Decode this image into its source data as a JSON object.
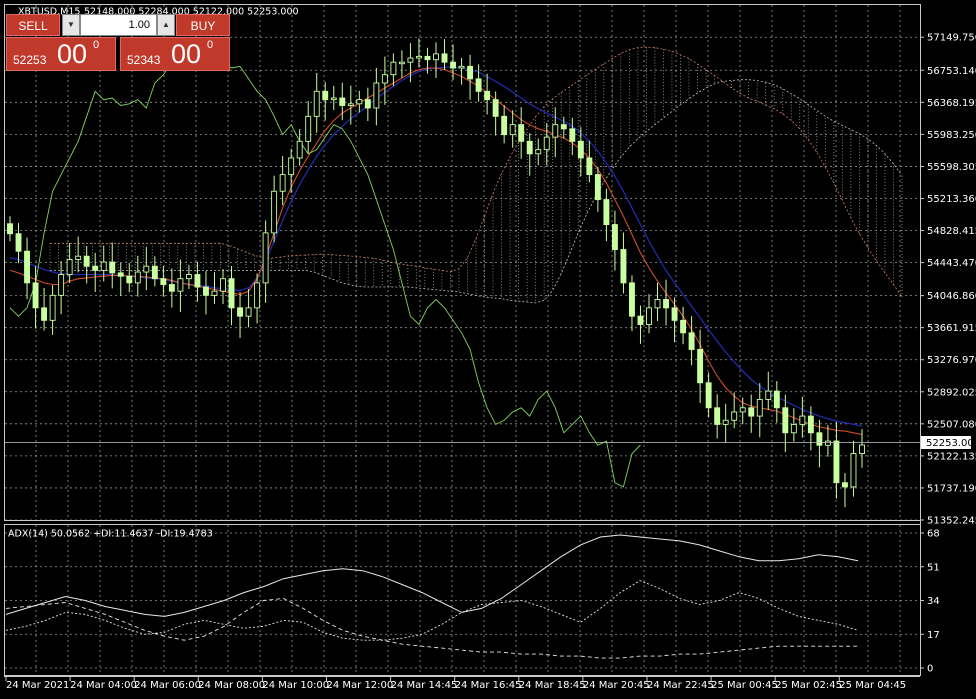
{
  "header": {
    "symbol": "XBTUSD,M15",
    "ohlc": "52148.000 52284.000 52122.000 52253.000"
  },
  "trade_panel": {
    "sell_label": "SELL",
    "buy_label": "BUY",
    "volume": "1.00",
    "sell_price_small": "52253",
    "sell_price_big": "00",
    "sell_price_sup": "0",
    "buy_price_small": "52343",
    "buy_price_big": "00",
    "buy_price_sup": "0",
    "step_down_icon": "triangle-down-icon",
    "step_up_icon": "triangle-up-icon"
  },
  "colors": {
    "background": "#000000",
    "grid": "#c8c8c8",
    "bull": "#c8ffa0",
    "ma_fast": "#d24a2c",
    "ma_slow": "#1f2aa8",
    "chikou": "#7fd65a",
    "cloud": "#c8c8c8",
    "panel_red": "#c0392b"
  },
  "chart_data": [
    {
      "type": "candlestick",
      "title": "XBTUSD,M15",
      "ylim": [
        51352.245,
        57536.9
      ],
      "yticks": [
        "57149.750",
        "56753.140",
        "56368.195",
        "55983.250",
        "55598.305",
        "55213.360",
        "54828.415",
        "54443.470",
        "54046.860",
        "53661.915",
        "53276.970",
        "52892.025",
        "52507.080",
        "52122.135",
        "51737.190",
        "51352.245"
      ],
      "current_price": "52253.000",
      "grid": true,
      "close": [
        54790,
        54580,
        54200,
        53900,
        53750,
        54050,
        54300,
        54480,
        54520,
        54400,
        54350,
        54450,
        54320,
        54280,
        54200,
        54330,
        54400,
        54250,
        54180,
        54100,
        54250,
        54300,
        54150,
        54050,
        54100,
        54250,
        53900,
        53800,
        53900,
        54200,
        54800,
        55300,
        55500,
        55700,
        55900,
        56200,
        56500,
        56400,
        56420,
        56330,
        56350,
        56400,
        56300,
        56600,
        56700,
        56850,
        56850,
        56900,
        56920,
        56880,
        56950,
        56850,
        56780,
        56800,
        56650,
        56500,
        56400,
        56200,
        55980,
        56100,
        55900,
        55750,
        55800,
        55950,
        56100,
        56050,
        55900,
        55700,
        55500,
        55200,
        54900,
        54600,
        54200,
        53800,
        53700,
        53900,
        54000,
        53900,
        53750,
        53600,
        53400,
        53000,
        52700,
        52500,
        52550,
        52650,
        52700,
        52600,
        52800,
        52900,
        52700,
        52400,
        52500,
        52600,
        52400,
        52250,
        52300,
        51800,
        51750,
        52150,
        52253
      ],
      "ma_fast": [
        54350,
        54320,
        54280,
        54240,
        54200,
        54180,
        54180,
        54220,
        54250,
        54260,
        54270,
        54280,
        54290,
        54290,
        54280,
        54280,
        54270,
        54260,
        54250,
        54230,
        54200,
        54180,
        54160,
        54140,
        54120,
        54100,
        54080,
        54060,
        54100,
        54250,
        54500,
        54800,
        55100,
        55350,
        55550,
        55720,
        55880,
        56030,
        56150,
        56240,
        56300,
        56360,
        56420,
        56480,
        56540,
        56600,
        56660,
        56720,
        56760,
        56780,
        56780,
        56760,
        56720,
        56680,
        56620,
        56560,
        56480,
        56400,
        56320,
        56240,
        56160,
        56100,
        56050,
        56020,
        55980,
        55940,
        55880,
        55800,
        55700,
        55560,
        55400,
        55200,
        55000,
        54780,
        54560,
        54380,
        54220,
        54080,
        53940,
        53800,
        53640,
        53460,
        53260,
        53080,
        52940,
        52840,
        52760,
        52720,
        52700,
        52680,
        52660,
        52620,
        52580,
        52540,
        52500,
        52470,
        52450,
        52430,
        52420,
        52400,
        52380
      ],
      "ma_slow": [
        54500,
        54480,
        54440,
        54400,
        54360,
        54330,
        54310,
        54300,
        54300,
        54300,
        54300,
        54300,
        54300,
        54290,
        54280,
        54270,
        54260,
        54250,
        54240,
        54220,
        54200,
        54180,
        54170,
        54160,
        54140,
        54130,
        54120,
        54110,
        54140,
        54260,
        54460,
        54700,
        54950,
        55180,
        55380,
        55560,
        55720,
        55860,
        55980,
        56080,
        56170,
        56250,
        56330,
        56410,
        56490,
        56560,
        56630,
        56690,
        56740,
        56770,
        56780,
        56790,
        56790,
        56780,
        56760,
        56730,
        56680,
        56620,
        56560,
        56490,
        56420,
        56350,
        56290,
        56240,
        56190,
        56140,
        56080,
        56000,
        55900,
        55780,
        55640,
        55480,
        55300,
        55100,
        54900,
        54700,
        54520,
        54350,
        54200,
        54060,
        53920,
        53780,
        53640,
        53500,
        53370,
        53250,
        53140,
        53040,
        52960,
        52890,
        52830,
        52780,
        52730,
        52680,
        52640,
        52600,
        52570,
        52540,
        52520,
        52500,
        52480
      ]
    },
    {
      "type": "line",
      "title": "ADX(14) 50.0562 +DI:11.4637 -DI:19.4783",
      "indicator": "ADX(14)",
      "adx": "50.0562",
      "plus_di": "11.4637",
      "minus_di": "19.4783",
      "ylim": [
        0,
        68
      ],
      "yticks": [
        "68",
        "51",
        "34",
        "17",
        "0"
      ],
      "x_labels": [
        "24 Mar 2021",
        "24 Mar 04:00",
        "24 Mar 06:00",
        "24 Mar 08:00",
        "24 Mar 10:00",
        "24 Mar 12:00",
        "24 Mar 14:45",
        "24 Mar 16:45",
        "24 Mar 18:45",
        "24 Mar 20:45",
        "24 Mar 22:45",
        "25 Mar 00:45",
        "25 Mar 02:45",
        "25 Mar 04:45"
      ],
      "series": [
        {
          "name": "ADX",
          "values": [
            27,
            30,
            33,
            36,
            34,
            31,
            29,
            27,
            26,
            28,
            31,
            34,
            38,
            41,
            45,
            47,
            49,
            50,
            49,
            46,
            42,
            38,
            33,
            28,
            30,
            35,
            42,
            49,
            56,
            62,
            66,
            67,
            66,
            65,
            64,
            62,
            59,
            56,
            54,
            54,
            55,
            57,
            56,
            54
          ]
        },
        {
          "name": "+DI",
          "values": [
            30,
            31,
            32,
            33,
            30,
            27,
            23,
            19,
            16,
            14,
            16,
            21,
            28,
            34,
            35,
            30,
            24,
            19,
            16,
            14,
            12,
            11,
            10,
            9,
            8,
            8,
            7,
            7,
            6,
            6,
            5,
            5,
            6,
            6,
            7,
            7,
            8,
            9,
            10,
            11,
            11,
            11,
            11,
            11
          ]
        },
        {
          "name": "-DI",
          "values": [
            19,
            21,
            24,
            28,
            27,
            24,
            20,
            17,
            18,
            22,
            24,
            22,
            20,
            21,
            24,
            23,
            18,
            15,
            14,
            14,
            15,
            17,
            22,
            28,
            32,
            33,
            34,
            31,
            27,
            23,
            30,
            38,
            44,
            40,
            35,
            32,
            34,
            38,
            35,
            30,
            26,
            24,
            22,
            19
          ]
        }
      ]
    }
  ]
}
